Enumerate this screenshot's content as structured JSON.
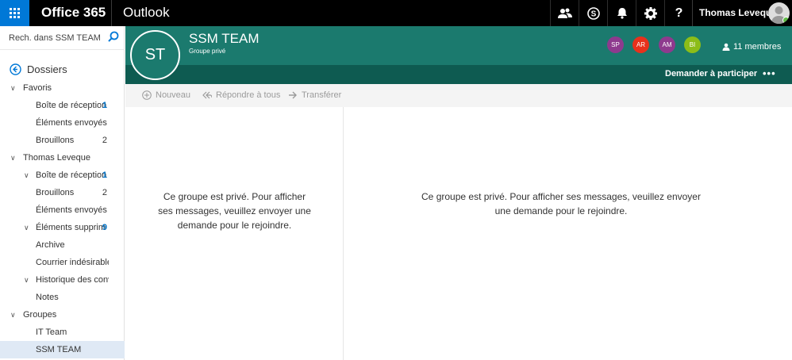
{
  "topbar": {
    "brand": "Office 365",
    "app": "Outlook",
    "user_name": "Thomas Leveque",
    "icons": [
      "people-icon",
      "skype-icon",
      "bell-icon",
      "gear-icon",
      "help-icon"
    ]
  },
  "sidebar": {
    "search_placeholder": "Rech. dans SSM TEAM",
    "folders_title": "Dossiers",
    "items": [
      {
        "label": "Favoris",
        "count": "",
        "level": 0,
        "chevron": true
      },
      {
        "label": "Boîte de réception",
        "count": "1",
        "level": 1,
        "chevron": false,
        "count_style": "blue"
      },
      {
        "label": "Éléments envoyés",
        "count": "",
        "level": 1,
        "chevron": false
      },
      {
        "label": "Brouillons",
        "count": "2",
        "level": 1,
        "chevron": false
      },
      {
        "label": "Thomas Leveque",
        "count": "",
        "level": 0,
        "chevron": true
      },
      {
        "label": "Boîte de réception",
        "count": "1",
        "level": 1,
        "chevron": true,
        "count_style": "blue"
      },
      {
        "label": "Brouillons",
        "count": "2",
        "level": 1,
        "chevron": false
      },
      {
        "label": "Éléments envoyés",
        "count": "",
        "level": 1,
        "chevron": false
      },
      {
        "label": "Éléments supprim",
        "count": "9",
        "level": 1,
        "chevron": true,
        "count_style": "blue"
      },
      {
        "label": "Archive",
        "count": "",
        "level": 1,
        "chevron": false
      },
      {
        "label": "Courrier indésirable",
        "count": "",
        "level": 1,
        "chevron": false
      },
      {
        "label": "Historique des conve",
        "count": "",
        "level": 1,
        "chevron": true
      },
      {
        "label": "Notes",
        "count": "",
        "level": 1,
        "chevron": false
      },
      {
        "label": "Groupes",
        "count": "",
        "level": 0,
        "chevron": true
      },
      {
        "label": "IT Team",
        "count": "",
        "level": 1,
        "chevron": false
      },
      {
        "label": "SSM TEAM",
        "count": "",
        "level": 1,
        "chevron": false,
        "selected": true
      }
    ]
  },
  "group": {
    "initials": "ST",
    "name": "SSM TEAM",
    "type": "Groupe privé",
    "members": [
      {
        "initials": "SP",
        "color": "#8e3a8e"
      },
      {
        "initials": "AR",
        "color": "#e8311c"
      },
      {
        "initials": "AM",
        "color": "#8e3a8e"
      },
      {
        "initials": "BI",
        "color": "#8cbd18"
      }
    ],
    "members_count": "11 membres",
    "join_label": "Demander à participer",
    "more_label": "•••"
  },
  "toolbar": {
    "new_label": "Nouveau",
    "reply_all_label": "Répondre à tous",
    "forward_label": "Transférer"
  },
  "list_pane": {
    "message": "Ce groupe est privé. Pour afficher ses messages, veuillez envoyer une demande pour le rejoindre."
  },
  "reading_pane": {
    "message": "Ce groupe est privé. Pour afficher ses messages, veuillez envoyer une demande pour le rejoindre."
  },
  "colors": {
    "accent": "#0078d7",
    "group_header": "#1b7a6e",
    "group_strip": "#0e5b51",
    "unread_count": "#0072c6"
  }
}
